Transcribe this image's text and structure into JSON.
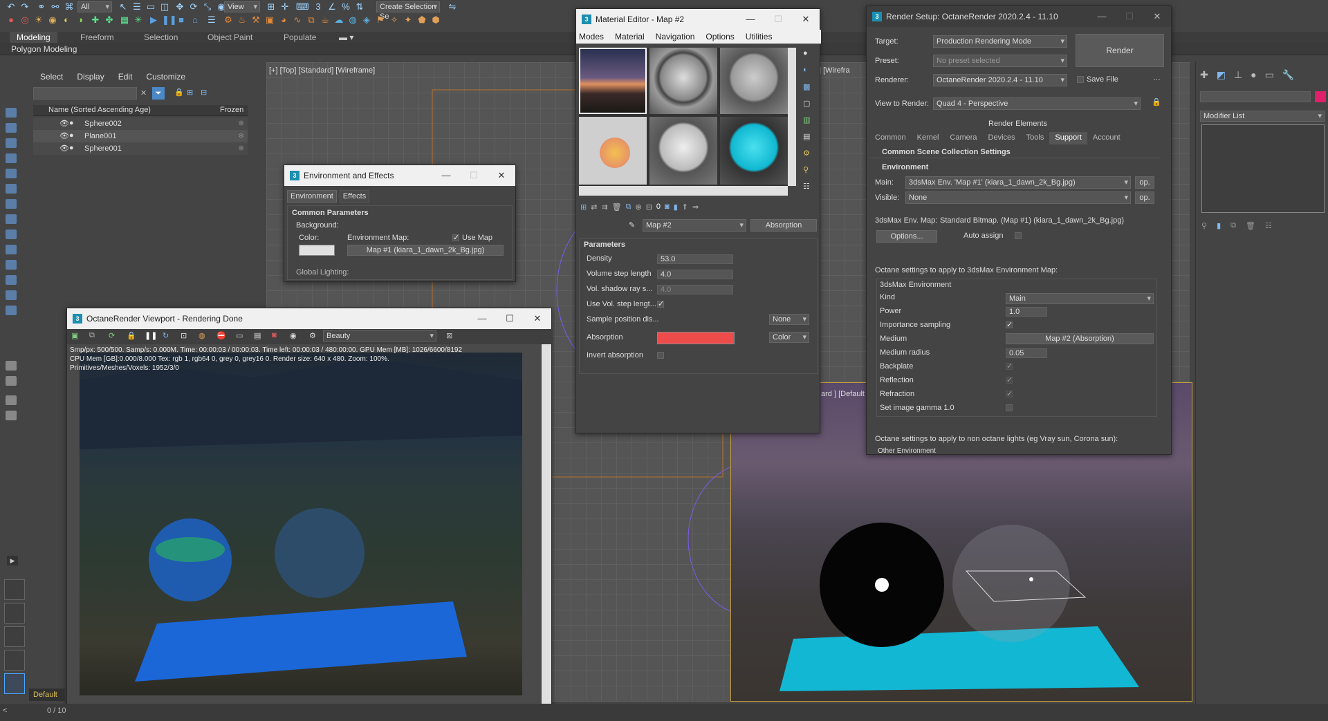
{
  "toolbar": {
    "selection_filter": "All",
    "view_dropdown": "View",
    "create_selection_set": "Create Selection Se"
  },
  "ribbon": {
    "tabs": [
      "Modeling",
      "Freeform",
      "Selection",
      "Object Paint",
      "Populate"
    ],
    "active_tab": "Modeling",
    "sub_label": "Polygon Modeling"
  },
  "scene_explorer": {
    "menu": [
      "Select",
      "Display",
      "Edit",
      "Customize"
    ],
    "column_name": "Name (Sorted Ascending Age)",
    "column_frozen": "Frozen",
    "rows": [
      "Sphere002",
      "Plane001",
      "Sphere001"
    ]
  },
  "viewports": {
    "top_label": "[+] [Top] [Standard] [Wireframe]",
    "frag_top_right": "ard ] [Wirefra",
    "frag_bottom_right": "ard ] [Default"
  },
  "env_effects": {
    "title": "Environment and Effects",
    "tabs": [
      "Environment",
      "Effects"
    ],
    "section": "Common Parameters",
    "background": "Background:",
    "color": "Color:",
    "env_map": "Environment Map:",
    "use_map": "Use Map",
    "map_button": "Map #1 (kiara_1_dawn_2k_Bg.jpg)",
    "global_lighting": "Global Lighting:"
  },
  "octane_vp": {
    "title": "OctaneRender Viewport - Rendering Done",
    "pass_dropdown": "Beauty",
    "stats1": "Smp/px: 500/500.   Samp/s: 0.000M.   Time: 00:00:03 / 00:00:03.   Time left: 00:00:03 / 480:00:00.   GPU Mem [MB]: 1026/6600/8192",
    "stats2": "CPU Mem [GB]:0.000/8.000   Tex: rgb 1, rgb64 0, grey 0, grey16 0.   Render size: 640 x 480.   Zoom: 100%.",
    "stats3": "Primitives/Meshes/Voxels: 1952/3/0"
  },
  "mat_editor": {
    "title": "Material Editor - Map #2",
    "menu": [
      "Modes",
      "Material",
      "Navigation",
      "Options",
      "Utilities"
    ],
    "map_name": "Map #2",
    "map_type": "Absorption",
    "section": "Parameters",
    "params": [
      {
        "label": "Density",
        "value": "53.0"
      },
      {
        "label": "Volume step length",
        "value": "4.0"
      },
      {
        "label": "Vol. shadow ray s...",
        "value": "4.0"
      }
    ],
    "use_vol_step": "Use Vol. step lengt...",
    "sample_pos": "Sample position dis...",
    "sample_pos_value": "None",
    "absorption": "Absorption",
    "absorption_mode": "Color",
    "invert_absorption": "Invert absorption",
    "absorption_color": "#ee4b4b"
  },
  "render_setup": {
    "title": "Render Setup: OctaneRender 2020.2.4 - 11.10",
    "target_label": "Target:",
    "target_value": "Production Rendering Mode",
    "preset_label": "Preset:",
    "preset_value": "No preset selected",
    "renderer_label": "Renderer:",
    "renderer_value": "OctaneRender 2020.2.4 - 11.10",
    "save_file": "Save File",
    "view_label": "View to Render:",
    "view_value": "Quad 4 - Perspective",
    "render_button": "Render",
    "render_elements": "Render Elements",
    "tabs": [
      "Common",
      "Kernel",
      "Camera",
      "Devices",
      "Tools",
      "Support",
      "Account"
    ],
    "active_tab": "Support",
    "section1": "Common Scene Collection Settings",
    "section2": "Environment",
    "main_label": "Main:",
    "main_value": "3dsMax Env. 'Map #1' (kiara_1_dawn_2k_Bg.jpg)",
    "visible_label": "Visible:",
    "visible_value": "None",
    "op": "op.",
    "env_map_label": "3dsMax Env. Map:",
    "env_map_value": "Standard Bitmap. (Map #1) (kiara_1_dawn_2k_Bg.jpg)",
    "options_button": "Options...",
    "auto_assign": "Auto assign",
    "octane_settings_1": "Octane settings to apply to 3dsMax Environment Map:",
    "group_title": "3dsMax Environment",
    "kind_label": "Kind",
    "kind_value": "Main",
    "power_label": "Power",
    "power_value": "1.0",
    "importance": "Importance sampling",
    "medium_label": "Medium",
    "medium_value": "Map #2 (Absorption)",
    "medium_radius_label": "Medium radius",
    "medium_radius_value": "0.05",
    "backplate": "Backplate",
    "reflection": "Reflection",
    "refraction": "Refraction",
    "gamma": "Set image gamma 1.0",
    "octane_settings_2": "Octane settings to apply to non octane lights (eg Vray sun, Corona sun):",
    "other_env": "Other Environment"
  },
  "right_panel": {
    "modifier_list": "Modifier List"
  },
  "status": {
    "layer": "Default",
    "frame": "0 / 10"
  }
}
